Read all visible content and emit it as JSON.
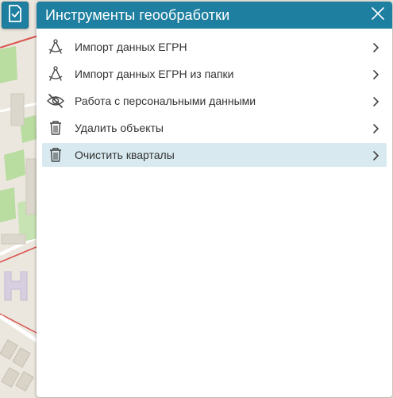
{
  "colors": {
    "accent": "#1e7fa0",
    "active_row": "#d8eaf0",
    "text": "#333333"
  },
  "tool_button": {
    "icon": "document-check-icon"
  },
  "panel": {
    "title": "Инструменты геообработки",
    "close_icon": "close-icon",
    "items": [
      {
        "label": "Импорт данных ЕГРН",
        "icon": "compass-icon",
        "active": false
      },
      {
        "label": "Импорт данных ЕГРН из папки",
        "icon": "compass-icon",
        "active": false
      },
      {
        "label": "Работа с персональными данными",
        "icon": "eye-off-icon",
        "active": false
      },
      {
        "label": "Удалить объекты",
        "icon": "trash-icon",
        "active": false
      },
      {
        "label": "Очистить кварталы",
        "icon": "trash-icon",
        "active": true
      }
    ]
  }
}
